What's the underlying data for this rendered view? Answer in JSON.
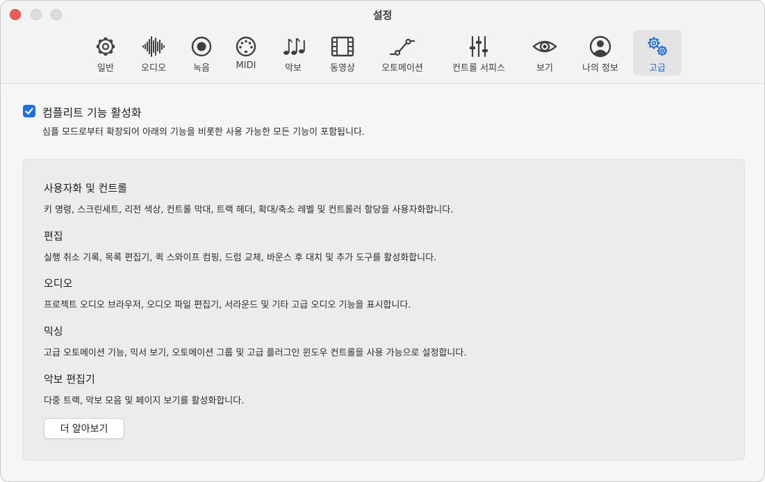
{
  "window": {
    "title": "설정"
  },
  "tabs": [
    {
      "label": "일반",
      "icon": "gear-icon"
    },
    {
      "label": "오디오",
      "icon": "waveform-icon"
    },
    {
      "label": "녹음",
      "icon": "record-icon"
    },
    {
      "label": "MIDI",
      "icon": "midi-port-icon"
    },
    {
      "label": "악보",
      "icon": "music-notes-icon"
    },
    {
      "label": "동영상",
      "icon": "film-icon"
    },
    {
      "label": "오토메이션",
      "icon": "automation-curve-icon"
    },
    {
      "label": "컨트롤 서피스",
      "icon": "sliders-icon"
    },
    {
      "label": "보기",
      "icon": "eye-icon"
    },
    {
      "label": "나의 정보",
      "icon": "person-circle-icon"
    },
    {
      "label": "고급",
      "icon": "gears-icon",
      "active": true
    }
  ],
  "complete_features": {
    "checked": true,
    "label": "컴플리트 기능 활성화",
    "description": "심플 모드로부터 확장되어 아래의 기능을 비롯한 사용 가능한 모든 기능이 포함됩니다."
  },
  "sections": [
    {
      "title": "사용자화 및 컨트롤",
      "description": "키 명령, 스크린세트, 리전 색상, 컨트롤 막대, 트랙 헤더, 확대/축소 레벨 및 컨트롤러 할당을 사용자화합니다."
    },
    {
      "title": "편집",
      "description": "실행 취소 기록, 목록 편집기, 퀵 스와이프 컴핑, 드럼 교체, 바운스 후 대치 및 추가 도구를 활성화합니다."
    },
    {
      "title": "오디오",
      "description": "프로젝트 오디오 브라우저, 오디오 파일 편집기, 서라운드 및 기타 고급 오디오 기능을 표시합니다."
    },
    {
      "title": "믹싱",
      "description": "고급 오토메이션 기능, 믹서 보기, 오토메이션 그룹 및 고급 플러그인 윈도우 컨트롤을 사용 가능으로 설정합니다."
    },
    {
      "title": "악보 편집기",
      "description": "다중 트랙, 악보 모음 및 페이지 보기를 활성화합니다."
    }
  ],
  "learn_more_label": "더 알아보기",
  "colors": {
    "accent": "#1f6fe5",
    "close": "#ee5e56"
  }
}
